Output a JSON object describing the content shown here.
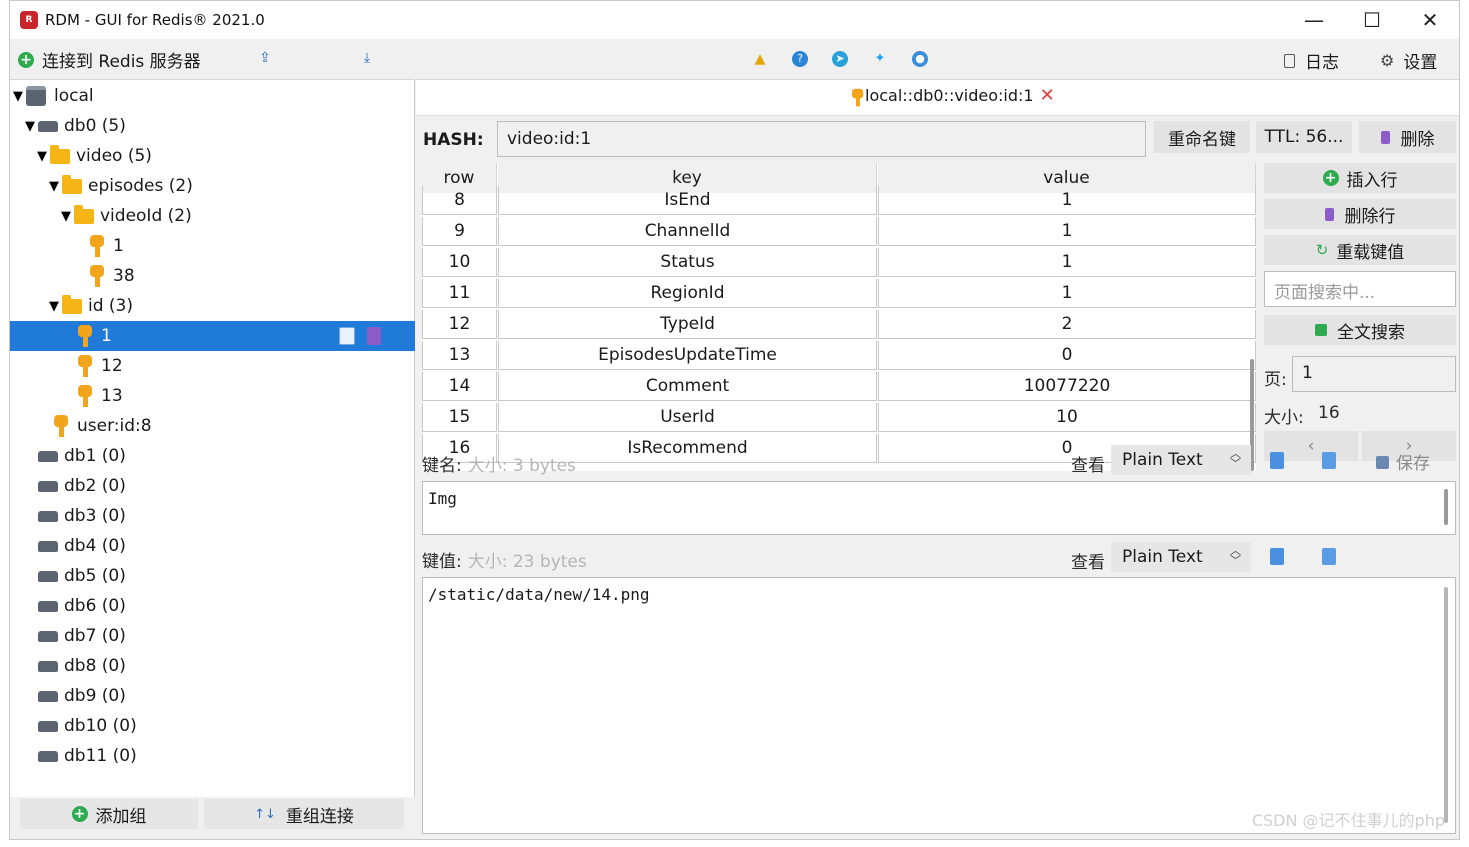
{
  "window": {
    "title": "RDM - GUI for Redis® 2021.0",
    "controls": {
      "minimize": "—",
      "maximize": "☐",
      "close": "✕"
    }
  },
  "left_toolbar": {
    "connect_label": "连接到 Redis 服务器"
  },
  "tree": {
    "server": "local",
    "db0": "db0  (5)",
    "video": "video (5)",
    "episodes": "episodes (2)",
    "videoId": "videoId (2)",
    "videoId_keys": [
      "1",
      "38"
    ],
    "id_folder": "id (3)",
    "id_keys": [
      "1",
      "12",
      "13"
    ],
    "user_key": "user:id:8",
    "dbs": [
      "db1  (0)",
      "db2  (0)",
      "db3  (0)",
      "db4  (0)",
      "db5  (0)",
      "db6  (0)",
      "db7  (0)",
      "db8  (0)",
      "db9  (0)",
      "db10  (0)",
      "db11  (0)"
    ]
  },
  "left_bottom": {
    "add_group": "添加组",
    "reconnect": "重组连接"
  },
  "right_toolbar": {
    "log": "日志",
    "settings": "设置"
  },
  "tab": {
    "label": "local::db0::video:id:1",
    "close": "✕"
  },
  "hash": {
    "label": "HASH:",
    "key": "video:id:1",
    "rename": "重命名键",
    "ttl": "TTL:  56...",
    "delete": "删除"
  },
  "table": {
    "headers": [
      "row",
      "key",
      "value"
    ],
    "rows": [
      {
        "row": "8",
        "key": "IsEnd",
        "value": "1"
      },
      {
        "row": "9",
        "key": "ChannelId",
        "value": "1"
      },
      {
        "row": "10",
        "key": "Status",
        "value": "1"
      },
      {
        "row": "11",
        "key": "RegionId",
        "value": "1"
      },
      {
        "row": "12",
        "key": "TypeId",
        "value": "2"
      },
      {
        "row": "13",
        "key": "EpisodesUpdateTime",
        "value": "0"
      },
      {
        "row": "14",
        "key": "Comment",
        "value": "10077220"
      },
      {
        "row": "15",
        "key": "UserId",
        "value": "10"
      },
      {
        "row": "16",
        "key": "IsRecommend",
        "value": "0"
      }
    ]
  },
  "side": {
    "insert_row": "插入行",
    "delete_row": "删除行",
    "reload": "重载键值",
    "search_placeholder": "页面搜索中...",
    "fulltext": "全文搜索",
    "page_label": "页:",
    "page_value": "1",
    "size_label": "大小:",
    "size_value": "16",
    "save": "保存"
  },
  "key_editor": {
    "label": "键名:",
    "size": "大小: 3 bytes",
    "view_label": "查看",
    "format": "Plain Text",
    "content": "Img"
  },
  "value_editor": {
    "label": "键值:",
    "size": "大小: 23 bytes",
    "view_label": "查看",
    "format": "Plain Text",
    "content": "/static/data/new/14.png"
  },
  "watermark": "CSDN @记不住事儿的php",
  "colors": {
    "selection": "#1f7ad8",
    "key_icon": "#f2a51a",
    "folder": "#f5b516",
    "add_green": "#2eaa4f",
    "trash_purple": "#8c5cc8",
    "close_red": "#e03b3b"
  }
}
